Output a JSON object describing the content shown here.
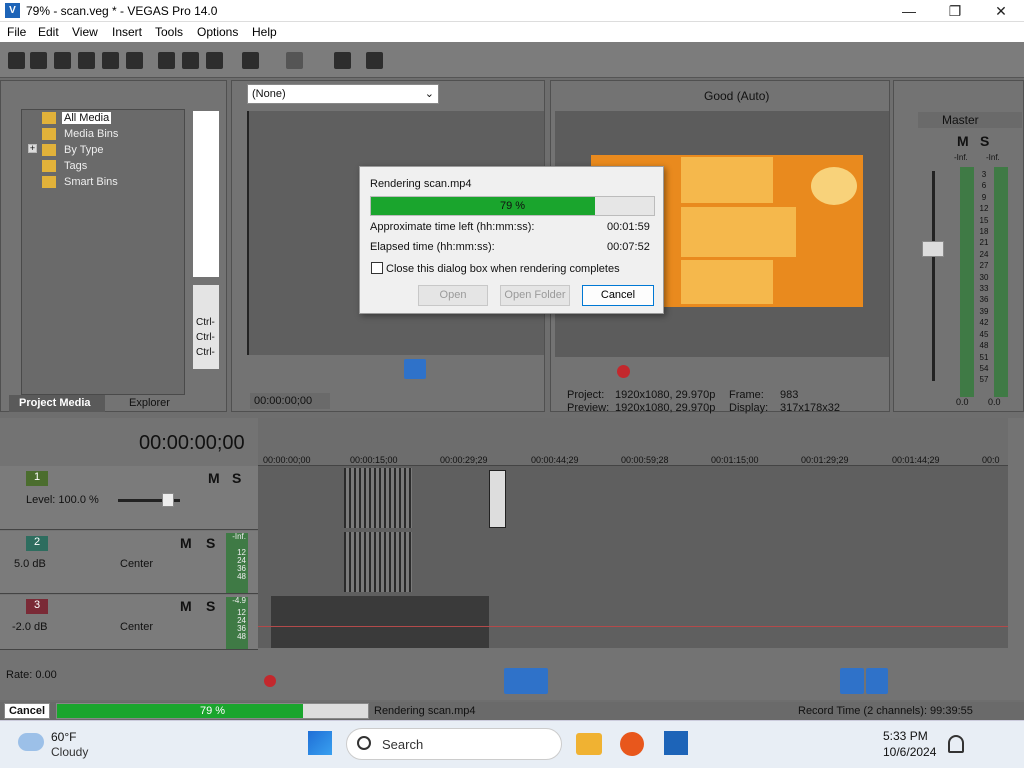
{
  "window": {
    "title": "79% - scan.veg * - VEGAS Pro 14.0",
    "logo": "V"
  },
  "menu": [
    "File",
    "Edit",
    "View",
    "Insert",
    "Tools",
    "Options",
    "Help"
  ],
  "media": {
    "tree": [
      "All Media",
      "Media Bins",
      "By Type",
      "Tags",
      "Smart Bins"
    ],
    "expand_glyph": "+",
    "tabs": {
      "project_media": "Project Media",
      "explorer": "Explorer"
    },
    "ctrl": [
      "Ctrl-",
      "Ctrl-",
      "Ctrl-"
    ]
  },
  "trimmer": {
    "dropdown": "(None)",
    "timecode": "00:00:00;00"
  },
  "preview": {
    "quality": "Good (Auto)",
    "project_label": "Project:",
    "project_val": "1920x1080, 29.970p",
    "preview_label": "Preview:",
    "preview_val": "1920x1080, 29.970p",
    "frame_label": "Frame:",
    "frame_val": "983",
    "display_label": "Display:",
    "display_val": "317x178x32"
  },
  "master": {
    "title": "Master",
    "m": "M",
    "s": "S",
    "inf_left": "-Inf.",
    "inf_right": "-Inf.",
    "scale": [
      "3",
      "6",
      "9",
      "12",
      "15",
      "18",
      "21",
      "24",
      "27",
      "30",
      "33",
      "36",
      "39",
      "42",
      "45",
      "48",
      "51",
      "54",
      "57"
    ],
    "val_left": "0.0",
    "val_right": "0.0"
  },
  "dialog": {
    "title": "Rendering scan.mp4",
    "progress_label": "79 %",
    "progress": 0.79,
    "time_left_label": "Approximate time left (hh:mm:ss):",
    "time_left": "00:01:59",
    "elapsed_label": "Elapsed time (hh:mm:ss):",
    "elapsed": "00:07:52",
    "checkbox_label": "Close this dialog box when rendering completes",
    "open": "Open",
    "open_folder": "Open Folder",
    "cancel": "Cancel"
  },
  "timeline": {
    "timecode": "00:00:00;00",
    "ruler": [
      "00:00:00;00",
      "00:00:15;00",
      "00:00:29;29",
      "00:00:44;29",
      "00:00:59;28",
      "00:01:15;00",
      "00:01:29;29",
      "00:01:44;29",
      "00:0"
    ],
    "tracks": [
      {
        "num": "1",
        "label": "Level: 100.0 %",
        "m": "M",
        "s": "S"
      },
      {
        "num": "2",
        "label": "5.0 dB",
        "pan": "Center",
        "m": "M",
        "s": "S",
        "meter": [
          "-Inf.",
          "12",
          "24",
          "36",
          "48"
        ]
      },
      {
        "num": "3",
        "label": "-2.0 dB",
        "pan": "Center",
        "m": "M",
        "s": "S",
        "meter": [
          "-4.9",
          "12",
          "24",
          "36",
          "48"
        ]
      }
    ],
    "rate": "Rate: 0.00"
  },
  "status": {
    "cancel": "Cancel",
    "progress_label": "79 %",
    "progress": 0.79,
    "text": "Rendering scan.mp4",
    "record": "Record Time (2 channels): 99:39:55"
  },
  "taskbar": {
    "temp": "60°F",
    "weather": "Cloudy",
    "search": "Search",
    "time": "5:33 PM",
    "date": "10/6/2024"
  }
}
